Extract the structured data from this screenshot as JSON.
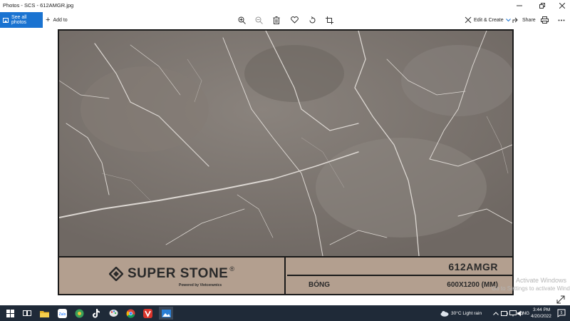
{
  "window": {
    "title": "Photos - SCS - 612AMGR.jpg",
    "controls": [
      "minimize",
      "maximize",
      "close"
    ]
  },
  "toolbar": {
    "see_all_label": "See all photos",
    "add_to_label": "Add to",
    "tools": [
      "zoom-in-icon",
      "zoom-out-icon",
      "delete-icon",
      "favorite-icon",
      "rotate-icon",
      "crop-icon"
    ],
    "edit_create_label": "Edit & Create",
    "share_label": "Share"
  },
  "image": {
    "logo_text": "SUPER STONE",
    "logo_reg": "®",
    "logo_sub": "Powered by Vietceramics",
    "code": "612AMGR",
    "finish": "BÓNG",
    "size": "600X1200 (MM)",
    "marble_color": "#7d7670",
    "panel_color": "#b39f8f"
  },
  "watermark": {
    "line1": "Activate Windows",
    "line2": "Go to Settings to activate Windows."
  },
  "taskbar": {
    "apps": [
      "start-icon",
      "task-view-icon",
      "file-explorer-icon",
      "zalo-icon",
      "app-icon",
      "tiktok-icon",
      "paint-icon",
      "chrome-icon",
      "vivaldi-icon",
      "photos-icon"
    ],
    "weather": "30°C  Light rain",
    "language": "ENG",
    "time": "3:44 PM",
    "date": "4/20/2022",
    "notification_count": "5"
  },
  "colors": {
    "accent": "#1a73d1",
    "taskbar": "#1f2a38"
  }
}
